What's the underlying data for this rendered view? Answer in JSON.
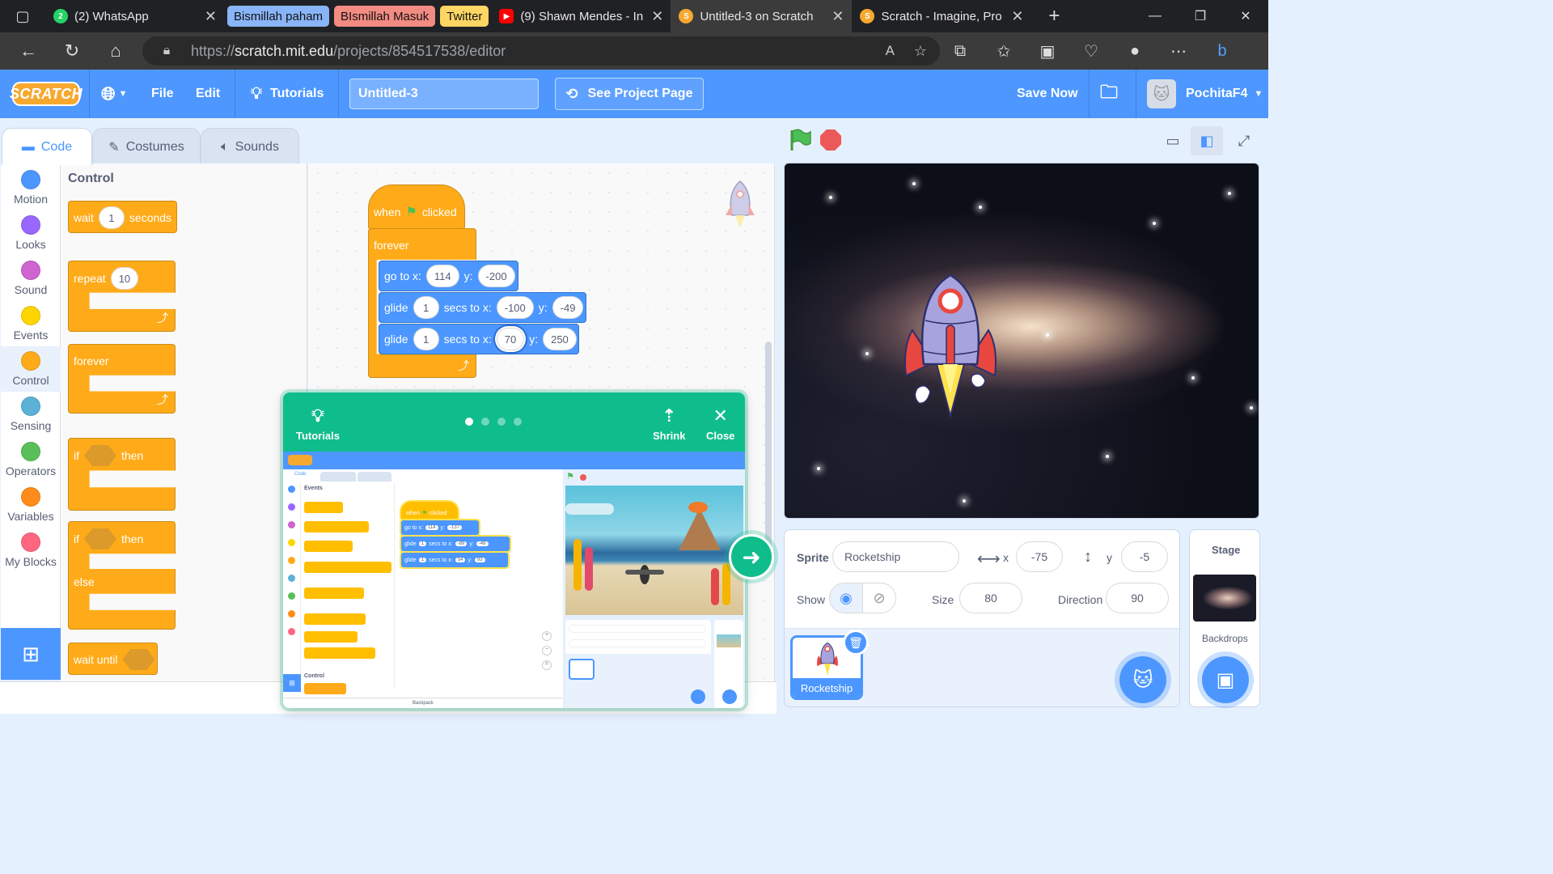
{
  "browser": {
    "tabs": [
      {
        "title": "(2) WhatsApp",
        "fav_color": "#25d366",
        "fav_text": "2"
      },
      {
        "title": "(9) Shawn Mendes - In",
        "fav_color": "#ff0000",
        "fav_text": "▶"
      },
      {
        "title": "Untitled-3 on Scratch",
        "fav_color": "#f7a82f",
        "fav_text": "S"
      },
      {
        "title": "Scratch - Imagine, Pro",
        "fav_color": "#f7a82f",
        "fav_text": "S"
      }
    ],
    "groups": [
      {
        "label": "Bismillah paham",
        "color": "#8ab4f8"
      },
      {
        "label": "BIsmillah Masuk",
        "color": "#f28b82"
      },
      {
        "label": "Twitter",
        "color": "#fdd663"
      }
    ],
    "url_prefix": "https://",
    "url_host": "scratch.mit.edu",
    "url_path": "/projects/854517538/editor"
  },
  "menubar": {
    "logo": "SCRATCH",
    "file": "File",
    "edit": "Edit",
    "tutorials": "Tutorials",
    "project_title": "Untitled-3",
    "see_project": "See Project Page",
    "save_now": "Save Now",
    "username": "PochitaF4"
  },
  "editor_tabs": {
    "code": "Code",
    "costumes": "Costumes",
    "sounds": "Sounds"
  },
  "categories": [
    {
      "label": "Motion",
      "color": "#4c97ff"
    },
    {
      "label": "Looks",
      "color": "#9966ff"
    },
    {
      "label": "Sound",
      "color": "#cf63cf"
    },
    {
      "label": "Events",
      "color": "#ffd500"
    },
    {
      "label": "Control",
      "color": "#ffab19"
    },
    {
      "label": "Sensing",
      "color": "#5cb1d6"
    },
    {
      "label": "Operators",
      "color": "#59c059"
    },
    {
      "label": "Variables",
      "color": "#ff8c1a"
    },
    {
      "label": "My Blocks",
      "color": "#ff6680"
    }
  ],
  "palette": {
    "title": "Control",
    "wait": "wait",
    "wait_val": "1",
    "seconds": "seconds",
    "repeat": "repeat",
    "repeat_val": "10",
    "forever": "forever",
    "if": "if",
    "then": "then",
    "else": "else",
    "wait_until": "wait until"
  },
  "script": {
    "when": "when",
    "clicked": "clicked",
    "forever": "forever",
    "goto": "go to x:",
    "goto_x": "114",
    "y": "y:",
    "goto_y": "-200",
    "glide": "glide",
    "secs_to_x": "secs to x:",
    "glide1_secs": "1",
    "glide1_x": "-100",
    "glide1_y": "-49",
    "glide2_secs": "1",
    "glide2_x": "70",
    "glide2_y": "250"
  },
  "tutorial": {
    "tutorials": "Tutorials",
    "shrink": "Shrink",
    "close": "Close",
    "mini_category": "Events",
    "mini_control": "Control",
    "mini_backpack": "Backpack",
    "mini_when": "when",
    "mini_clicked": "clicked",
    "mini_goto_x": "114",
    "mini_goto_y": "-137",
    "mini_g1_secs": "1",
    "mini_g1_x": "-89",
    "mini_g1_y": "-49",
    "mini_g2_secs": "1",
    "mini_g2_x": "54",
    "mini_g2_y": "93"
  },
  "sprite_info": {
    "sprite_label": "Sprite",
    "sprite_name": "Rocketship",
    "x_label": "x",
    "x": "-75",
    "y_label": "y",
    "y": "-5",
    "show_label": "Show",
    "size_label": "Size",
    "size": "80",
    "direction_label": "Direction",
    "direction": "90"
  },
  "sprites": [
    {
      "name": "Rocketship"
    }
  ],
  "stage_pane": {
    "title": "Stage",
    "backdrops": "Backdrops"
  }
}
